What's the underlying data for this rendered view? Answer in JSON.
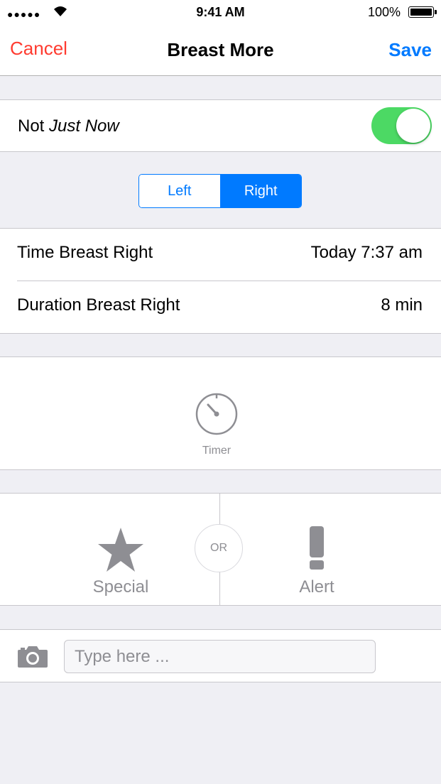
{
  "status_bar": {
    "signal": "●●●●●",
    "time": "9:41 AM",
    "battery_percent": "100%"
  },
  "nav": {
    "cancel_label": "Cancel",
    "title": "Breast More",
    "save_label": "Save"
  },
  "toggle_row": {
    "label_prefix": "Not ",
    "label_italic": "Just Now",
    "is_on": true
  },
  "segmented": {
    "options": [
      "Left",
      "Right"
    ],
    "selected": "Right"
  },
  "details": [
    {
      "label": "Time Breast Right",
      "value": "Today 7:37 am"
    },
    {
      "label": "Duration Breast Right",
      "value": "8 min"
    }
  ],
  "timer": {
    "label": "Timer"
  },
  "flags": {
    "special_label": "Special",
    "or_label": "OR",
    "alert_label": "Alert"
  },
  "note_input": {
    "placeholder": "Type here ...",
    "value": ""
  },
  "colors": {
    "accent": "#007aff",
    "cancel": "#ff3b30",
    "toggle_on": "#4cd964",
    "icon_gray": "#8e8e93",
    "background": "#efeff4"
  },
  "icons": {
    "wifi": "wifi-icon",
    "battery": "battery-icon",
    "timer": "timer-icon",
    "special": "star-icon",
    "alert": "exclamation-icon",
    "camera": "camera-icon"
  }
}
